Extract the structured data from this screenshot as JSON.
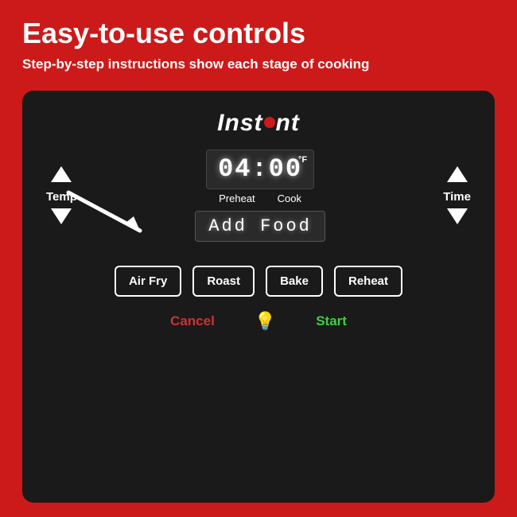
{
  "page": {
    "background_color": "#cc1a1a",
    "title": "Easy-to-use controls",
    "subtitle": "Step-by-step instructions show each stage of cooking"
  },
  "panel": {
    "logo": "Instant",
    "time_display": "04:00",
    "temp_unit": "°F",
    "stage_labels": [
      "Preheat",
      "Cook"
    ],
    "add_food_text": "Add Food",
    "temp_label": "Temp",
    "time_label": "Time",
    "buttons": [
      "Air Fry",
      "Roast",
      "Bake",
      "Reheat"
    ],
    "cancel_label": "Cancel",
    "start_label": "Start"
  }
}
